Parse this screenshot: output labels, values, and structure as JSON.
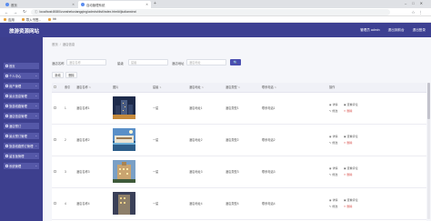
{
  "browser": {
    "tabs": [
      {
        "title": "首页"
      },
      {
        "title": "自动管理系统"
      }
    ],
    "url": "localhost:8080/zunsheluxiangqing/admin/dist/index.html#/jiudianxinxi",
    "bookmarks": [
      {
        "label": "应用"
      },
      {
        "label": "导入书签..."
      },
      {
        "label": "hb"
      }
    ]
  },
  "app": {
    "title": "旅游资源网站",
    "header_links": [
      "管理员 admin",
      "退出到前台",
      "退出登录"
    ]
  },
  "sidebar": {
    "items": [
      {
        "label": "首页"
      },
      {
        "label": "个人中心"
      },
      {
        "label": "用户管理"
      },
      {
        "label": "景点信息管理"
      },
      {
        "label": "旅游线路管理"
      },
      {
        "label": "酒店信息管理"
      },
      {
        "label": "酒店预订"
      },
      {
        "label": "景点预订管理"
      },
      {
        "label": "旅游线路预订管理"
      },
      {
        "label": "留言板管理"
      },
      {
        "label": "系统管理"
      }
    ]
  },
  "breadcrumb": {
    "home": "首页",
    "current": "酒店信息"
  },
  "search": {
    "field1_label": "酒店名称",
    "field1_placeholder": "酒店名称",
    "field2_label": "星级",
    "field2_placeholder": "星级",
    "field3_label": "酒店地址",
    "field3_placeholder": "酒店地址",
    "button": "🔍"
  },
  "actions": {
    "add": "新增",
    "delete": "删除"
  },
  "table": {
    "columns": [
      "",
      "索引",
      "酒店名称",
      "图片",
      "星级",
      "酒店地址",
      "酒店类型",
      "联系电话",
      "操作"
    ],
    "rows": [
      {
        "index": "1",
        "name": "酒店名称1",
        "star": "一星",
        "address": "酒店地址1",
        "type": "酒店类型1",
        "phone": "联系电话1"
      },
      {
        "index": "2",
        "name": "酒店名称2",
        "star": "一星",
        "address": "酒店地址2",
        "type": "酒店类型2",
        "phone": "联系电话2"
      },
      {
        "index": "3",
        "name": "酒店名称3",
        "star": "一星",
        "address": "酒店地址3",
        "type": "酒店类型3",
        "phone": "联系电话3"
      },
      {
        "index": "4",
        "name": "酒店名称4",
        "star": "一星",
        "address": "酒店地址4",
        "type": "酒店类型4",
        "phone": "联系电话4"
      }
    ],
    "row_actions": {
      "view": "详情",
      "edit": "修改",
      "comment": "查看评论",
      "delete": "删除"
    }
  }
}
